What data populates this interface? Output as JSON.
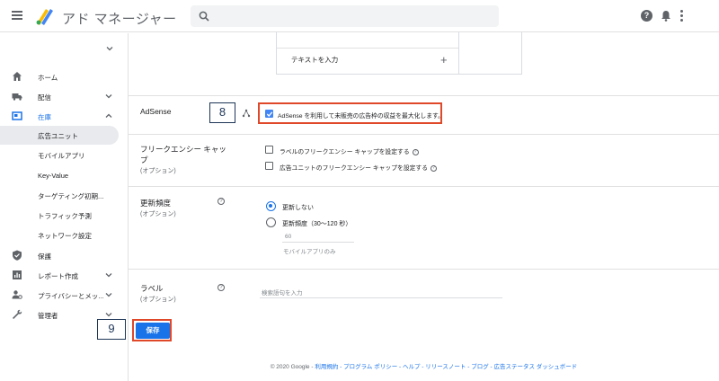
{
  "app": {
    "brand": "アド マネージャー"
  },
  "search": {
    "placeholder": ""
  },
  "sidebar": {
    "items": [
      {
        "label": "ホーム",
        "icon": "home-icon"
      },
      {
        "label": "配信",
        "icon": "truck-icon"
      },
      {
        "label": "在庫",
        "icon": "inventory-icon"
      }
    ],
    "subitems": [
      "広告ユニット",
      "モバイルアプリ",
      "Key-Value",
      "ターゲティング初期...",
      "トラフィック予測",
      "ネットワーク設定"
    ],
    "lower": [
      {
        "label": "保護",
        "icon": "shield-icon"
      },
      {
        "label": "レポート作成",
        "icon": "bar-chart-icon"
      },
      {
        "label": "プライバシーとメッ...",
        "icon": "privacy-icon"
      },
      {
        "label": "管理者",
        "icon": "wrench-icon"
      }
    ]
  },
  "card": {
    "text_input_label": "テキストを入力",
    "plus": "+"
  },
  "adsense": {
    "title": "AdSense",
    "checkbox_label": "AdSense を利用して未販売の広告枠の収益を最大化します。",
    "checked": true
  },
  "freq": {
    "title_line1": "フリークエンシー キャッ",
    "title_line2": "プ",
    "sub": "(オプション)",
    "opt1": "ラベルのフリークエンシー キャップを設定する",
    "opt2": "広告ユニットのフリークエンシー キャップを設定する"
  },
  "refresh": {
    "title": "更新頻度",
    "sub": "(オプション)",
    "opt1": "更新しない",
    "opt2": "更新頻度（30〜120 秒）",
    "value": "60",
    "hint": "モバイルアプリのみ"
  },
  "label_section": {
    "title": "ラベル",
    "sub": "(オプション)",
    "placeholder": "検索語句を入力"
  },
  "save_label": "保存",
  "footer": {
    "prefix": "© 2020 Google - ",
    "links": "利用規約 - プログラム ポリシー - ヘルプ - リリースノート - ブログ - 広告ステータス ダッシュボード"
  },
  "annotations": {
    "step8": "8",
    "step9": "9"
  },
  "colors": {
    "accent": "#1a73e8",
    "highlight": "#e0482a",
    "annotation": "#1d3557"
  }
}
